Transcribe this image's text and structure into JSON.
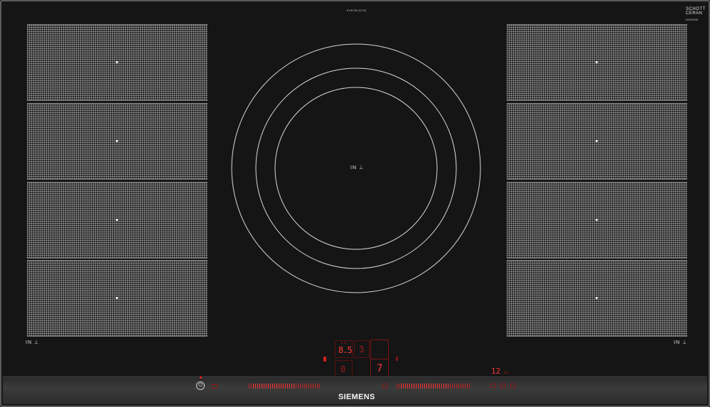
{
  "header": {
    "model_code": "EX975LXC1E"
  },
  "brand_corner": {
    "line1": "SCHOTT",
    "line2": "CERAN",
    "code": "0000000"
  },
  "left_zones": [
    {
      "name": "left-flex-zone-1"
    },
    {
      "name": "left-flex-zone-2"
    },
    {
      "name": "left-flex-zone-3"
    },
    {
      "name": "left-flex-zone-4"
    }
  ],
  "right_zones": [
    {
      "name": "right-flex-zone-1"
    },
    {
      "name": "right-flex-zone-2"
    },
    {
      "name": "right-flex-zone-3"
    },
    {
      "name": "right-flex-zone-4"
    }
  ],
  "center_zone": {
    "label": "IN",
    "icon": "induction-pan-icon"
  },
  "left_label": "IN",
  "right_label": "IN",
  "display": {
    "zone_power": "8.5",
    "zone_power_caption": "P M",
    "level_3": "3",
    "level_0": "0",
    "level_7": "7",
    "timer_value": "12",
    "timer_unit": "min",
    "timer_caption": "P M"
  },
  "power_button": {
    "icon": "power-icon",
    "glyph": "⏻"
  },
  "brand": {
    "logo": "SIEMENS"
  },
  "colors": {
    "glass": "#151515",
    "display_red": "#ff3a3a",
    "zone_grid": "#aaaaaa"
  }
}
